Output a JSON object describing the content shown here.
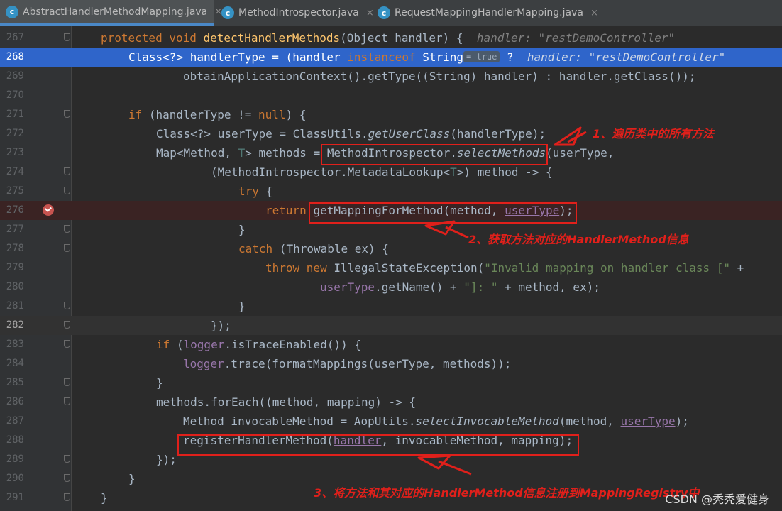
{
  "tabs": [
    {
      "icon": "c",
      "label": "AbstractHandlerMethodMapping.java",
      "close": "×"
    },
    {
      "icon": "c",
      "label": "MethodIntrospector.java",
      "close": "×"
    },
    {
      "icon": "c",
      "label": "RequestMappingHandlerMapping.java",
      "close": "×"
    }
  ],
  "lines": [
    "267",
    "268",
    "269",
    "270",
    "271",
    "272",
    "273",
    "274",
    "275",
    "276",
    "277",
    "278",
    "279",
    "280",
    "281",
    "282",
    "283",
    "284",
    "285",
    "286",
    "287",
    "288",
    "289",
    "290",
    "291"
  ],
  "code": {
    "l267": {
      "kw1": "protected void ",
      "fn": "detectHandlerMethods",
      "rest": "(Object handler) {",
      "hint": "handler: \"restDemoController\""
    },
    "l268": {
      "a": "Class<?> handlerType = (handler ",
      "kw": "instanceof",
      "b": " String",
      "pill": "= true",
      "c": " ?",
      "hint": "handler: \"restDemoController\""
    },
    "l269": {
      "a": "obtainApplicationContext().getType((String) handler) : handler.getClass());"
    },
    "l271": {
      "kw": "if",
      "a": " (handlerType != ",
      "kw2": "null",
      "b": ") {"
    },
    "l272": {
      "a": "Class<?> userType = ClassUtils.",
      "it": "getUserClass",
      "b": "(handlerType);"
    },
    "l273": {
      "a": "Map<Method, ",
      "tp": "T",
      "b": "> methods = ",
      "c": "MethodIntrospector.",
      "it": "selectMethods",
      "d": "(userType,"
    },
    "l274": {
      "a": "(MethodIntrospector.MetadataLookup<",
      "tp": "T",
      "b": ">) method -> {"
    },
    "l275": {
      "kw": "try",
      "a": " {"
    },
    "l276": {
      "kw": "return ",
      "a": "getMappingForMethod(method, ",
      "ul": "userType",
      "b": ");"
    },
    "l277": {
      "a": "}"
    },
    "l278": {
      "kw": "catch",
      "a": " (Throwable ex) {"
    },
    "l279": {
      "kw": "throw new ",
      "a": "IllegalStateException(",
      "str": "\"Invalid mapping on handler class [\"",
      "b": " +"
    },
    "l280": {
      "ul": "userType",
      "a": ".getName() + ",
      "str": "\"]: \"",
      "b": " + method, ex);"
    },
    "l281": {
      "a": "}"
    },
    "l282": {
      "a": "});"
    },
    "l283": {
      "kw": "if",
      "a": " (",
      "fld": "logger",
      "b": ".isTraceEnabled()) {"
    },
    "l284": {
      "fld": "logger",
      "a": ".trace(formatMappings(userType, methods));"
    },
    "l285": {
      "a": "}"
    },
    "l286": {
      "a": "methods.forEach((method, mapping) -> {"
    },
    "l287": {
      "a": "Method invocableMethod = AopUtils.",
      "it": "selectInvocableMethod",
      "b": "(method, ",
      "ul": "userType",
      "c": ");"
    },
    "l288": {
      "a": "registerHandlerMethod(",
      "ul": "handler",
      "b": ", invocableMethod, mapping);"
    },
    "l289": {
      "a": "});"
    },
    "l290": {
      "a": "}"
    },
    "l291": {
      "a": "}"
    }
  },
  "annotations": {
    "note1": "1、遍历类中的所有方法",
    "note2": "2、获取方法对应的HandlerMethod信息",
    "note3": "3、将方法和其对应的HandlerMethod信息注册到MappingRegistry中"
  },
  "watermark": "CSDN @秃秃爱健身",
  "colors": {
    "annotation": "#e0201b",
    "selection": "#2f65ca",
    "keyword": "#cc7832"
  }
}
